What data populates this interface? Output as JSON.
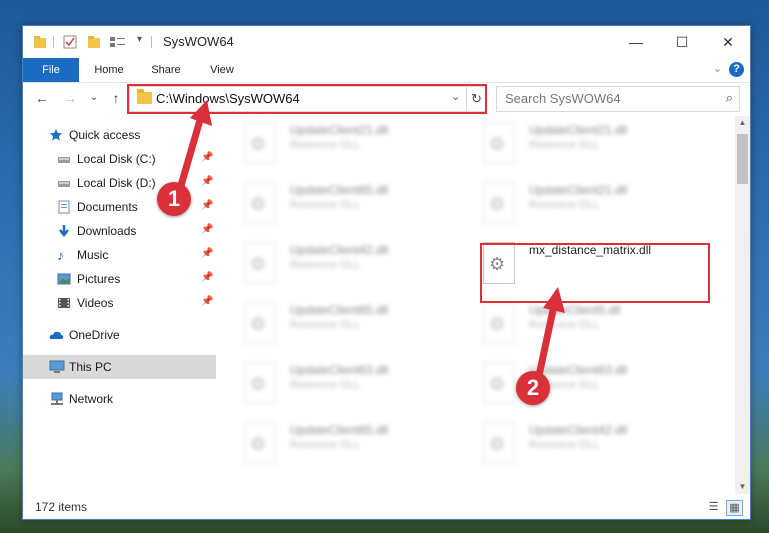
{
  "window": {
    "title": "SysWOW64",
    "controls": {
      "minimize": "—",
      "maximize": "☐",
      "close": "✕"
    }
  },
  "ribbon": {
    "tabs": [
      "File",
      "Home",
      "Share",
      "View"
    ],
    "help": "?",
    "expand": "⌄"
  },
  "nav": {
    "back": "←",
    "forward": "→",
    "recent": "⌄",
    "up": "↑",
    "address": "C:\\Windows\\SysWOW64",
    "address_chevron": "⌄",
    "refresh": "↻",
    "search_placeholder": "Search SysWOW64",
    "search_icon": "⌕"
  },
  "sidebar": {
    "items": [
      {
        "label": "Quick access",
        "icon": "star-icon",
        "pinned": false
      },
      {
        "label": "Local Disk (C:)",
        "icon": "drive-icon",
        "pinned": true
      },
      {
        "label": "Local Disk (D:)",
        "icon": "drive-icon",
        "pinned": true
      },
      {
        "label": "Documents",
        "icon": "documents-icon",
        "pinned": true
      },
      {
        "label": "Downloads",
        "icon": "downloads-icon",
        "pinned": true
      },
      {
        "label": "Music",
        "icon": "music-icon",
        "pinned": true
      },
      {
        "label": "Pictures",
        "icon": "pictures-icon",
        "pinned": true
      },
      {
        "label": "Videos",
        "icon": "videos-icon",
        "pinned": true
      },
      {
        "label": "OneDrive",
        "icon": "onedrive-icon",
        "pinned": false
      },
      {
        "label": "This PC",
        "icon": "pc-icon",
        "pinned": false,
        "selected": true
      },
      {
        "label": "Network",
        "icon": "network-icon",
        "pinned": false
      }
    ],
    "pin_glyph": "📌"
  },
  "files": [
    {
      "name": "UpdateClient21.dll",
      "type": "Resource DLL",
      "blurred": true
    },
    {
      "name": "UpdateClient21.dll",
      "type": "Resource DLL",
      "blurred": true
    },
    {
      "name": "UpdateClient65.dll",
      "type": "Resource DLL",
      "blurred": true
    },
    {
      "name": "UpdateClient21.dll",
      "type": "Resource DLL",
      "blurred": true
    },
    {
      "name": "UpdateClient42.dll",
      "type": "Resource DLL",
      "blurred": true
    },
    {
      "name": "mx_distance_matrix.dll",
      "type": "",
      "blurred": false
    },
    {
      "name": "UpdateClient65.dll",
      "type": "Resource DLL",
      "blurred": true
    },
    {
      "name": "UpdateClient5.dll",
      "type": "Resource DLL",
      "blurred": true
    },
    {
      "name": "UpdateClient63.dll",
      "type": "Resource DLL",
      "blurred": true
    },
    {
      "name": "UpdateClient63.dll",
      "type": "Resource DLL",
      "blurred": true
    },
    {
      "name": "UpdateClient65.dll",
      "type": "Resource DLL",
      "blurred": true
    },
    {
      "name": "UpdateClient42.dll",
      "type": "Resource DLL",
      "blurred": true
    }
  ],
  "status": {
    "item_count": "172 items"
  },
  "annotations": {
    "badge1": "1",
    "badge2": "2",
    "color": "#d9303a"
  }
}
